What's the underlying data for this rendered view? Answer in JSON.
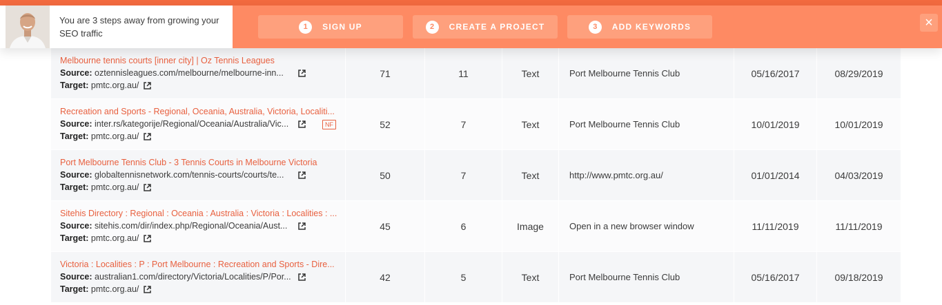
{
  "banner": {
    "intro_text": "You are 3 steps away from growing your SEO traffic",
    "steps": [
      {
        "num": "1",
        "label": "SIGN UP"
      },
      {
        "num": "2",
        "label": "CREATE A PROJECT"
      },
      {
        "num": "3",
        "label": "ADD KEYWORDS"
      }
    ],
    "close_label": "×",
    "accent_color": "#fe8a63"
  },
  "table": {
    "source_label": "Source:",
    "target_label": "Target:",
    "rows": [
      {
        "title": "Melbourne tennis courts [inner city] | Oz Tennis Leagues",
        "source": "oztennisleagues.com/melbourne/melbourne-inn...",
        "target": "pmtc.org.au/",
        "badge": "",
        "dr": "71",
        "ext": "11",
        "type": "Text",
        "anchor": "Port Melbourne Tennis Club",
        "first_seen": "05/16/2017",
        "last_seen": "08/29/2019"
      },
      {
        "title": "Recreation and Sports - Regional, Oceania, Australia, Victoria, Localiti...",
        "source": "inter.rs/kategorije/Regional/Oceania/Australia/Vic...",
        "target": "pmtc.org.au/",
        "badge": "NF",
        "dr": "52",
        "ext": "7",
        "type": "Text",
        "anchor": "Port Melbourne Tennis Club",
        "first_seen": "10/01/2019",
        "last_seen": "10/01/2019"
      },
      {
        "title": "Port Melbourne Tennis Club - 3 Tennis Courts in Melbourne Victoria",
        "source": "globaltennisnetwork.com/tennis-courts/courts/te...",
        "target": "pmtc.org.au/",
        "badge": "",
        "dr": "50",
        "ext": "7",
        "type": "Text",
        "anchor": "http://www.pmtc.org.au/",
        "first_seen": "01/01/2014",
        "last_seen": "04/03/2019"
      },
      {
        "title": "Sitehis Directory : Regional : Oceania : Australia : Victoria : Localities : ...",
        "source": "sitehis.com/dir/index.php/Regional/Oceania/Aust...",
        "target": "pmtc.org.au/",
        "badge": "",
        "dr": "45",
        "ext": "6",
        "type": "Image",
        "anchor": "Open in a new browser window",
        "first_seen": "11/11/2019",
        "last_seen": "11/11/2019"
      },
      {
        "title": "Victoria : Localities : P : Port Melbourne : Recreation and Sports - Dire...",
        "source": "australian1.com/directory/Victoria/Localities/P/Por...",
        "target": "pmtc.org.au/",
        "badge": "",
        "dr": "42",
        "ext": "5",
        "type": "Text",
        "anchor": "Port Melbourne Tennis Club",
        "first_seen": "05/16/2017",
        "last_seen": "09/18/2019"
      }
    ]
  }
}
